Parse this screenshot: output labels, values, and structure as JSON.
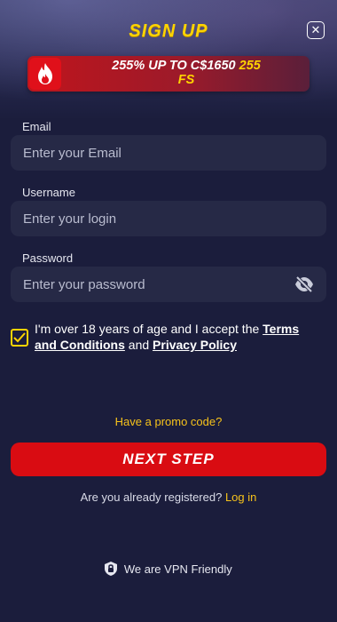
{
  "header": {
    "title": "SIGN UP",
    "close_icon": "close-icon"
  },
  "banner": {
    "icon": "fire-icon",
    "text_main": "255% UP TO C$1650",
    "text_highlight": "255",
    "text_tail": "FS"
  },
  "form": {
    "email": {
      "label": "Email",
      "placeholder": "Enter your Email",
      "value": ""
    },
    "username": {
      "label": "Username",
      "placeholder": "Enter your login",
      "value": ""
    },
    "password": {
      "label": "Password",
      "placeholder": "Enter your password",
      "value": "",
      "toggle_icon": "eye-off-icon"
    }
  },
  "agreement": {
    "checked": true,
    "text_before": "I'm over 18 years of age and I accept the",
    "terms_link": "Terms and Conditions",
    "and": "and",
    "privacy_link": "Privacy Policy"
  },
  "promo": {
    "label": "Have a promo code?"
  },
  "next_button": {
    "label": "NEXT STEP"
  },
  "login_prompt": {
    "text": "Are you already registered?",
    "link": "Log in"
  },
  "vpn": {
    "icon": "shield-icon",
    "text": "We are VPN Friendly"
  },
  "colors": {
    "background": "#1b1d3c",
    "accent_yellow": "#ffd400",
    "button_red": "#d90c12",
    "field_bg": "#262946"
  }
}
